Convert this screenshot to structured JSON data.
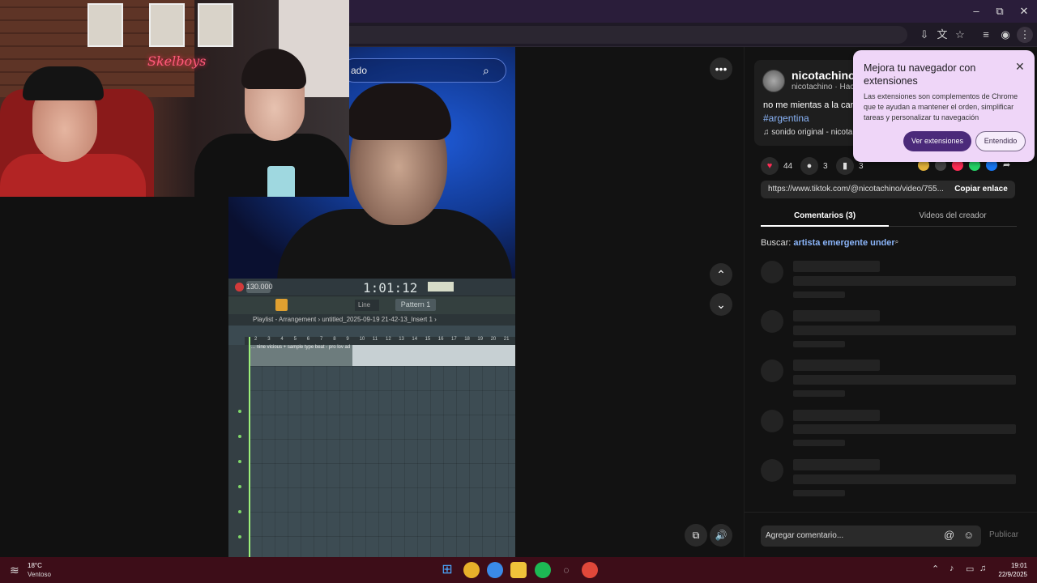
{
  "browser": {
    "window_controls": {
      "minimize": "–",
      "maximize": "⧉",
      "close": "✕"
    }
  },
  "video": {
    "search_text": "ado",
    "fl": {
      "bpm": "130.000",
      "time": "1:01:12",
      "line_mode": "Line",
      "pattern": "Pattern 1",
      "playlist_title": "Playlist - Arrangement › untitled_2025-09-19 21-42-13_Insert 1 ›",
      "clip_label": "... nine vicious + sample type beat - pro lov ad",
      "ruler": [
        "2",
        "3",
        "4",
        "5",
        "6",
        "7",
        "8",
        "9",
        "10",
        "11",
        "12",
        "13",
        "14",
        "15",
        "16",
        "17",
        "18",
        "19",
        "20",
        "21"
      ]
    },
    "webcam": {
      "neon_sign": "Skelboys"
    }
  },
  "controls": {
    "more_label": "•••",
    "up_label": "⌃",
    "down_label": "⌄",
    "volume_label": "🔊",
    "pip_label": "⧉"
  },
  "panel": {
    "author": {
      "name": "nicotachino",
      "sub": "nicotachino · Hace"
    },
    "caption": "no me mientas a la cara",
    "hashtag": "#argentina",
    "sound": "♫  sonido original - nicota",
    "stats": {
      "likes": "44",
      "comments": "3",
      "saves": "3"
    },
    "link": "https://www.tiktok.com/@nicotachino/video/755...",
    "copy_link": "Copiar enlace",
    "tabs": {
      "comments": "Comentarios (3)",
      "creator_videos": "Videos del creador"
    },
    "search_label": "Buscar:",
    "search_query": "artista emergente under",
    "comment_placeholder": "Agregar comentario...",
    "publish": "Publicar"
  },
  "ext_popup": {
    "title": "Mejora tu navegador con extensiones",
    "body": "Las extensiones son complementos de Chrome que te ayudan a mantener el orden, simplificar tareas y personalizar tu navegación",
    "primary": "Ver extensiones",
    "secondary": "Entendido",
    "close": "✕"
  },
  "taskbar": {
    "weather_temp": "18°C",
    "weather_desc": "Ventoso",
    "time": "19:01",
    "date": "22/9/2025"
  },
  "colors": {
    "accent": "#4b2a7a",
    "taskbar": "#3d0d18",
    "link": "#8ab4f8",
    "like": "#fe2c55"
  }
}
